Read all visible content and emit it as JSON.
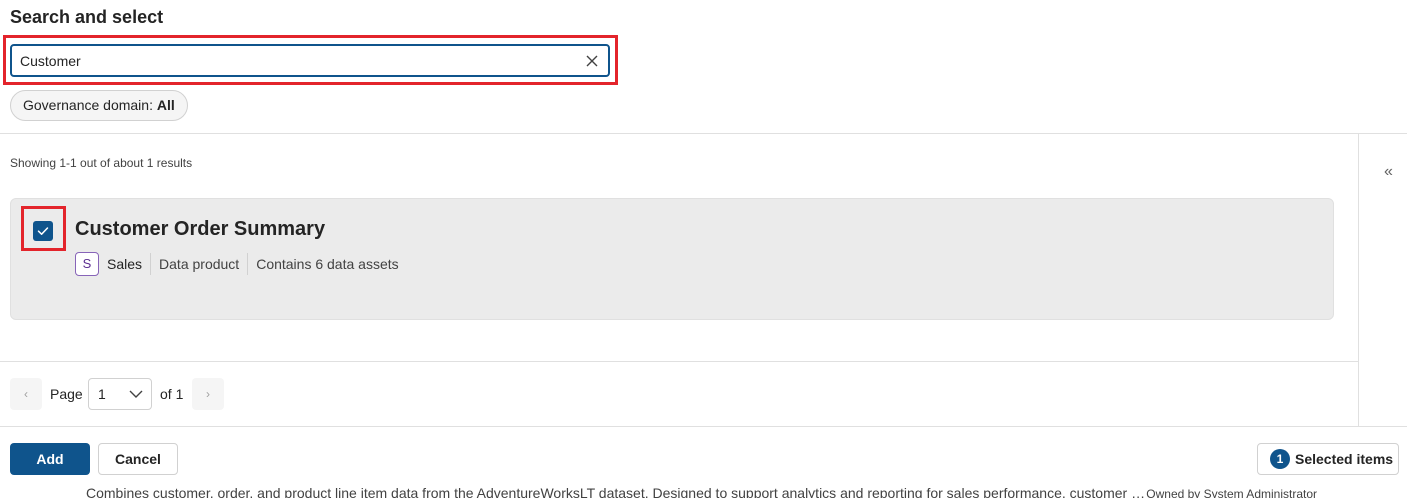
{
  "title": "Search and select",
  "search": {
    "value": "Customer",
    "clear_icon": "close-icon"
  },
  "filter": {
    "label": "Governance domain:",
    "value": "All"
  },
  "results": {
    "showing_text": "Showing 1-1 out of about 1 results",
    "items": [
      {
        "checked": true,
        "title": "Customer Order Summary",
        "domain_initial": "S",
        "domain": "Sales",
        "type": "Data product",
        "assets": "Contains 6 data assets",
        "description": "Combines customer, order, and product line item data from the AdventureWorksLT dataset. Designed to support analytics and reporting for sales performance, customer behavior, and product trends.",
        "owner": "Owned by System Administrator"
      }
    ]
  },
  "pagination": {
    "prev": "‹",
    "page_label": "Page",
    "page_value": "1",
    "of_label": "of 1",
    "next": "›"
  },
  "panel": {
    "collapse_glyph": "«"
  },
  "footer": {
    "add_label": "Add",
    "cancel_label": "Cancel",
    "selected_count": "1",
    "selected_label": "Selected items"
  },
  "colors": {
    "primary": "#0f548c",
    "highlight": "#e3242b",
    "domain_badge": "#8764b8"
  }
}
